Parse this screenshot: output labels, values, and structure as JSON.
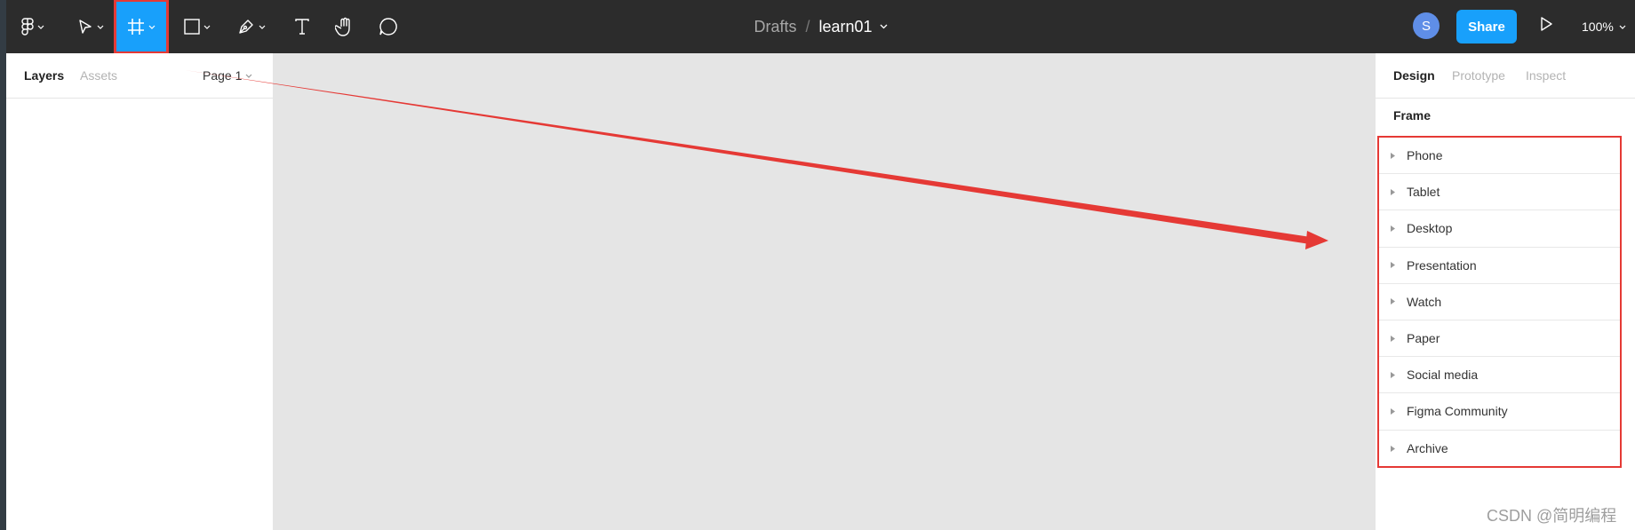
{
  "toolbar": {
    "breadcrumb_root": "Drafts",
    "breadcrumb_sep": "/",
    "file_name": "learn01",
    "avatar_initial": "S",
    "share_label": "Share",
    "zoom_label": "100%",
    "icons": [
      "figma-menu-icon",
      "move-tool-icon",
      "frame-tool-icon",
      "rectangle-tool-icon",
      "pen-tool-icon",
      "text-tool-icon",
      "hand-tool-icon",
      "comment-tool-icon",
      "play-icon"
    ]
  },
  "left_panel": {
    "tab_layers": "Layers",
    "tab_assets": "Assets",
    "page_selector": "Page 1"
  },
  "right_panel": {
    "tab_design": "Design",
    "tab_prototype": "Prototype",
    "tab_inspect": "Inspect",
    "section_title": "Frame",
    "presets": [
      {
        "label": "Phone"
      },
      {
        "label": "Tablet"
      },
      {
        "label": "Desktop"
      },
      {
        "label": "Presentation"
      },
      {
        "label": "Watch"
      },
      {
        "label": "Paper"
      },
      {
        "label": "Social media"
      },
      {
        "label": "Figma Community"
      },
      {
        "label": "Archive"
      }
    ]
  },
  "watermark": "CSDN @简明编程",
  "colors": {
    "accent": "#18a0fb",
    "annotation": "#e53935",
    "toolbar_bg": "#2c2c2c",
    "canvas_bg": "#e5e5e5"
  }
}
